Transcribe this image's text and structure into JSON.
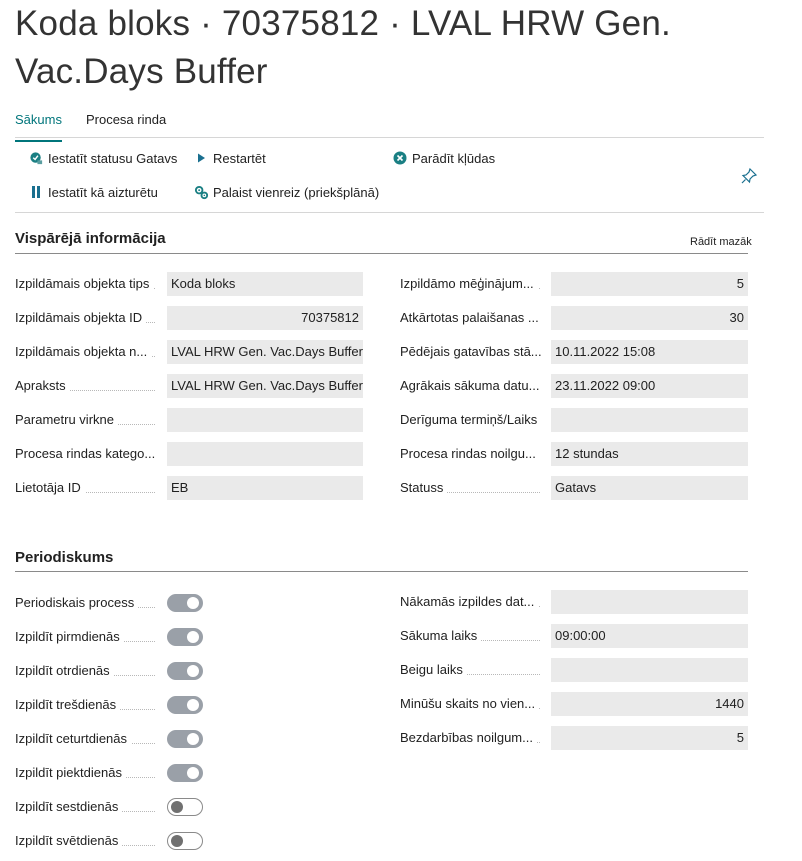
{
  "page": {
    "title": "Koda bloks · 70375812 · LVAL HRW Gen. Vac.Days Buffer"
  },
  "tabs": [
    {
      "label": "Sākums",
      "active": true
    },
    {
      "label": "Procesa rinda",
      "active": false
    }
  ],
  "actions": {
    "set_status_ready": "Iestatīt statusu Gatavs",
    "restart": "Restartēt",
    "show_errors": "Parādīt kļūdas",
    "set_on_hold": "Iestatīt kā aizturētu",
    "run_once": "Palaist vienreiz (priekšplānā)"
  },
  "general": {
    "title": "Vispārējā informācija",
    "show_less": "Rādīt mazāk",
    "left": [
      {
        "label": "Izpildāmais objekta tips",
        "value": "Koda bloks",
        "numeric": false
      },
      {
        "label": "Izpildāmais objekta ID",
        "value": "70375812",
        "numeric": true
      },
      {
        "label": "Izpildāmais objekta n...",
        "value": "LVAL HRW Gen. Vac.Days Buffer",
        "numeric": false
      },
      {
        "label": "Apraksts",
        "value": "LVAL HRW Gen. Vac.Days Buffer",
        "numeric": false
      },
      {
        "label": "Parametru virkne",
        "value": "",
        "numeric": false
      },
      {
        "label": "Procesa rindas katego...",
        "value": "",
        "numeric": false
      },
      {
        "label": "Lietotāja ID",
        "value": "EB",
        "numeric": false
      }
    ],
    "right": [
      {
        "label": "Izpildāmo mēģinājum...",
        "value": "5",
        "numeric": true
      },
      {
        "label": "Atkārtotas palaišanas ...",
        "value": "30",
        "numeric": true
      },
      {
        "label": "Pēdējais gatavības stā...",
        "value": "10.11.2022 15:08",
        "numeric": false
      },
      {
        "label": "Agrākais sākuma datu...",
        "value": "23.11.2022 09:00",
        "numeric": false
      },
      {
        "label": "Derīguma termiņš/Laiks",
        "value": "",
        "numeric": false
      },
      {
        "label": "Procesa rindas noilgu...",
        "value": "12 stundas",
        "numeric": false
      },
      {
        "label": "Statuss",
        "value": "Gatavs",
        "numeric": false
      }
    ]
  },
  "recurrence": {
    "title": "Periodiskums",
    "toggles": [
      {
        "label": "Periodiskais process",
        "on": true
      },
      {
        "label": "Izpildīt pirmdienās",
        "on": true
      },
      {
        "label": "Izpildīt otrdienās",
        "on": true
      },
      {
        "label": "Izpildīt trešdienās",
        "on": true
      },
      {
        "label": "Izpildīt ceturtdienās",
        "on": true
      },
      {
        "label": "Izpildīt piektdienās",
        "on": true
      },
      {
        "label": "Izpildīt sestdienās",
        "on": false
      },
      {
        "label": "Izpildīt svētdienās",
        "on": false
      }
    ],
    "right": [
      {
        "label": "Nākamās izpildes dat...",
        "value": "",
        "numeric": false
      },
      {
        "label": "Sākuma laiks",
        "value": "09:00:00",
        "numeric": false
      },
      {
        "label": "Beigu laiks",
        "value": "",
        "numeric": false
      },
      {
        "label": "Minūšu skaits no vien...",
        "value": "1440",
        "numeric": true
      },
      {
        "label": "Bezdarbības noilgum...",
        "value": "5",
        "numeric": true
      }
    ]
  },
  "colors": {
    "accent": "#00757b",
    "toggle_on": "#9aa0a8",
    "field_bg": "#eaeaea"
  }
}
